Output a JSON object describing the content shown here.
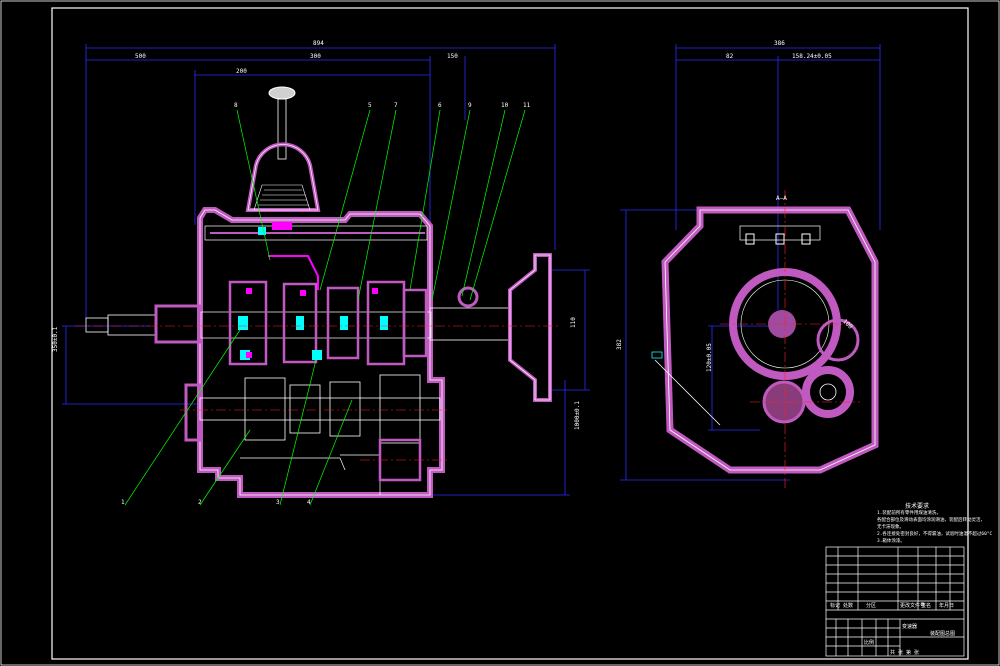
{
  "drawing": {
    "colors": {
      "background": "#000000",
      "frame": "#ffffff",
      "dimension": "#2b2bff",
      "housing_hatch": "#c05ac0",
      "housing_outline": "#ffffff",
      "leader": "#00ff00",
      "center_line": "#ff2020",
      "gear_fill": "#8a3c7a",
      "highlight": "#ff00ff",
      "cyan_part": "#00ffff"
    },
    "left_view": {
      "top_dimensions": [
        "894",
        "500",
        "300",
        "200",
        "150"
      ],
      "side_dimensions": [
        "350±0.1",
        "1000±0.1"
      ],
      "right_dimension": "110",
      "part_callouts_top": [
        "8",
        "5",
        "7",
        "6",
        "9",
        "10",
        "11"
      ],
      "part_callouts_bottom": [
        "1",
        "2",
        "3",
        "4"
      ]
    },
    "right_view": {
      "top_dimensions": [
        "386",
        "82",
        "158.24±0.05"
      ],
      "side_dimension": "382",
      "center_mark": "A—A",
      "shaft_dimension": "120±0.05",
      "angled_dimension": "100"
    },
    "requirements": {
      "title": "技术要求",
      "lines": [
        "1.装配前所有零件用煤油清洗，",
        "各配合部位及滑动表面均涂润滑油，装配后转动灵活，",
        "无卡滞现象。",
        "2.各连接处密封良好，不得漏油，试验时油温不超过60°C",
        "3.箱体涂漆。"
      ]
    },
    "title_block": {
      "drawing_name": "变速器",
      "school": "装配图总图",
      "rows": [
        "标记",
        "处数",
        "分区",
        "更改文件号",
        "签名",
        "年月日"
      ],
      "scale_label": "比例",
      "sheet": "共 张 第 张"
    }
  }
}
